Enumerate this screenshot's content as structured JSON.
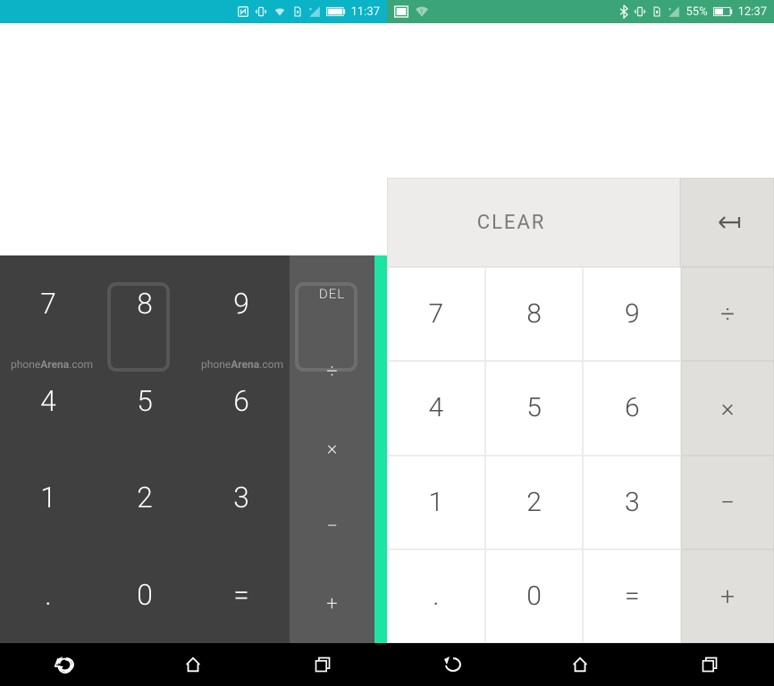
{
  "left": {
    "status": {
      "time": "11:37"
    },
    "keys": {
      "r0": [
        "7",
        "8",
        "9"
      ],
      "r1": [
        "4",
        "5",
        "6"
      ],
      "r2": [
        "1",
        "2",
        "3"
      ],
      "r3": [
        ".",
        "0",
        "="
      ]
    },
    "ops": {
      "del": "DEL",
      "div": "÷",
      "mul": "×",
      "sub": "−",
      "add": "+"
    },
    "watermark": {
      "pre": "phone",
      "bold": "Arena",
      "suf": ".com"
    }
  },
  "right": {
    "status": {
      "batt": "55%",
      "time": "12:37"
    },
    "clear": "CLEAR",
    "backspace": "⟻",
    "keys": {
      "r0": [
        "7",
        "8",
        "9"
      ],
      "r1": [
        "4",
        "5",
        "6"
      ],
      "r2": [
        "1",
        "2",
        "3"
      ],
      "r3": [
        ".",
        "0",
        "="
      ]
    },
    "ops": {
      "div": "÷",
      "mul": "×",
      "sub": "−",
      "add": "+"
    }
  }
}
